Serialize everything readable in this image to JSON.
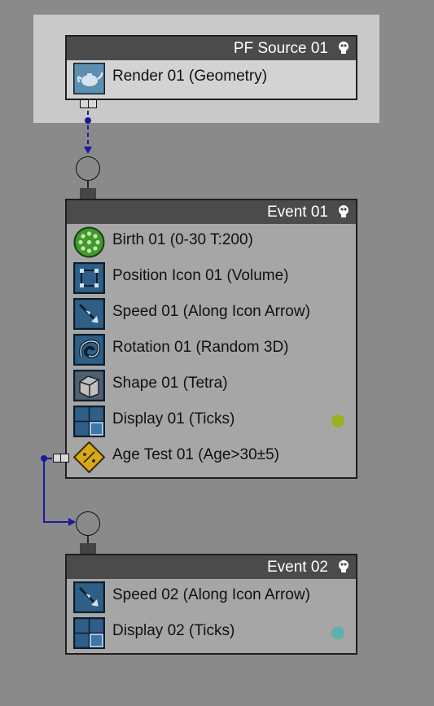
{
  "source": {
    "title": "PF Source 01",
    "items": [
      {
        "label": "Render 01 (Geometry)",
        "icon": "render-teapot-icon"
      }
    ]
  },
  "event1": {
    "title": "Event 01",
    "items": [
      {
        "label": "Birth 01 (0-30 T:200)",
        "icon": "birth-icon"
      },
      {
        "label": "Position Icon 01 (Volume)",
        "icon": "position-icon"
      },
      {
        "label": "Speed 01 (Along Icon Arrow)",
        "icon": "speed-icon"
      },
      {
        "label": "Rotation 01 (Random 3D)",
        "icon": "rotation-icon"
      },
      {
        "label": "Shape 01 (Tetra)",
        "icon": "shape-icon"
      },
      {
        "label": "Display 01 (Ticks)",
        "icon": "display-icon",
        "color": "#9ab21e"
      },
      {
        "label": "Age Test 01 (Age>30±5)",
        "icon": "age-test-icon"
      }
    ]
  },
  "event2": {
    "title": "Event 02",
    "items": [
      {
        "label": "Speed 02 (Along Icon Arrow)",
        "icon": "speed-icon"
      },
      {
        "label": "Display 02 (Ticks)",
        "icon": "display-icon",
        "color": "#5fb1b1"
      }
    ]
  },
  "colors": {
    "background": "#8a8a8a",
    "header": "#4b4b4b",
    "wire": "#1a1aa0",
    "source_bg": "#c9c9c9"
  }
}
